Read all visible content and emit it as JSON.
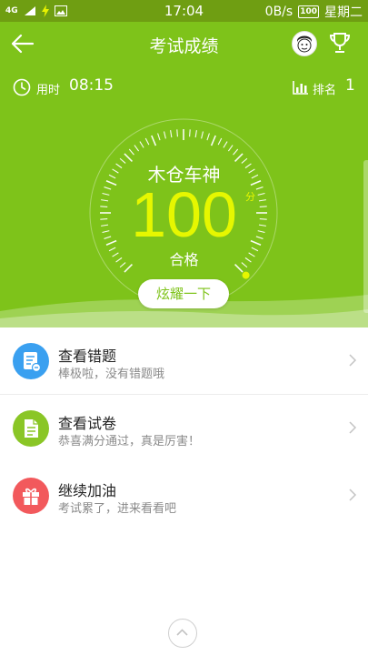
{
  "status_bar": {
    "network": "4G",
    "time": "17:04",
    "speed": "0B/s",
    "battery": "100",
    "weekday": "星期二"
  },
  "header": {
    "title": "考试成绩",
    "time_label": "用时",
    "time_value": "08:15",
    "rank_label": "排名",
    "rank_value": "1",
    "nickname": "木仓车神",
    "score": "100",
    "score_unit": "分",
    "result": "合格",
    "share_button": "炫耀一下",
    "score_fraction": 1.0
  },
  "menu": [
    {
      "title": "查看错题",
      "subtitle": "棒极啦，没有错题哦",
      "icon": "wrong-questions-icon",
      "color": "#3aa0f0"
    },
    {
      "title": "查看试卷",
      "subtitle": "恭喜满分通过，真是厉害！",
      "icon": "exam-paper-icon",
      "color": "#8ac626"
    },
    {
      "title": "继续加油",
      "subtitle": "考试累了，进来看看吧",
      "icon": "gift-icon",
      "color": "#f2595c"
    }
  ],
  "colors": {
    "header_bg": "#7ec31a",
    "status_bg": "#6f9e12",
    "score": "#e6f700"
  }
}
